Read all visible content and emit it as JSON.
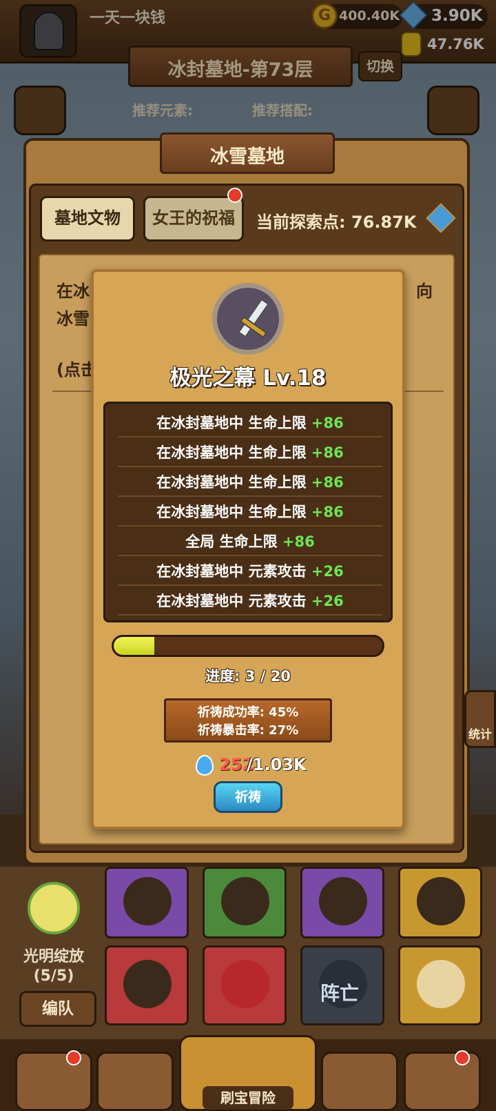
{
  "header": {
    "player_name": "一天一块钱",
    "coins": "400.40K",
    "gems": "3.90K",
    "jars": "47.76K"
  },
  "level": {
    "title": "冰封墓地-第73层",
    "switch_label": "切换",
    "recommended_element": "推荐元素:",
    "recommended_combo": "推荐搭配:"
  },
  "panel": {
    "title": "冰雪墓地",
    "tabs": [
      "墓地文物",
      "女王的祝福"
    ],
    "explore_label": "当前探索点: 76.87K",
    "background_text": [
      "在冰",
      "冰雪",
      "(点击",
      "向"
    ]
  },
  "popup": {
    "item_name": "极光之幕 Lv.18",
    "stats": [
      {
        "label": "在冰封墓地中 生命上限",
        "value": "+86"
      },
      {
        "label": "在冰封墓地中 生命上限",
        "value": "+86"
      },
      {
        "label": "在冰封墓地中 生命上限",
        "value": "+86"
      },
      {
        "label": "在冰封墓地中 生命上限",
        "value": "+86"
      },
      {
        "label": "全局 生命上限",
        "value": "+86"
      },
      {
        "label": "在冰封墓地中 元素攻击",
        "value": "+26"
      },
      {
        "label": "在冰封墓地中 元素攻击",
        "value": "+26"
      }
    ],
    "progress": {
      "current": 3,
      "total": 20,
      "label": "进度: 3 / 20"
    },
    "success_rate": "祈祷成功率: 45%",
    "crit_rate": "祈祷暴击率: 27%",
    "cost_current": "252",
    "cost_max": "/1.03K",
    "pray_label": "祈祷"
  },
  "team": {
    "name": "光明绽放",
    "count": "(5/5)",
    "edit_label": "编队",
    "dead_label": "阵亡"
  },
  "side": {
    "stats_label": "统计"
  },
  "nav": {
    "center_label": "刷宝冒险"
  },
  "colors": {
    "stat_value": "#6ee64e",
    "cost_current": "#ff5a4a",
    "progress_fill": "#e8ec3a"
  }
}
